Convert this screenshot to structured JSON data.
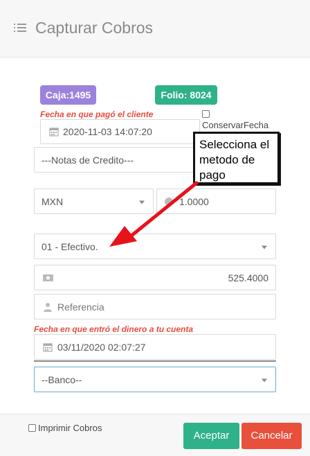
{
  "header": {
    "title": "Capturar Cobros",
    "icon": "list-icon"
  },
  "badges": {
    "caja": "Caja:1495",
    "folio": "Folio: 8024"
  },
  "labels": {
    "fecha_cliente": "Fecha en que pagó el cliente",
    "conservar_fecha": "ConservarFecha",
    "fecha_cuenta": "Fecha en que entró el dinero a tu cuenta"
  },
  "fields": {
    "fecha_pago": "2020-11-03 14:07:20",
    "notas_credito": "---Notas de Credito---",
    "moneda": "MXN",
    "tipo_cambio": "1.0000",
    "metodo_pago": "01 - Efectivo.",
    "monto": "525.4000",
    "referencia_placeholder": "Referencia",
    "fecha_deposito": "03/11/2020 02:07:27",
    "banco": "--Banco--"
  },
  "callout": {
    "text": "Selecciona el metodo de pago"
  },
  "footer": {
    "imprimir_label": "Imprimir Cobros",
    "aceptar": "Aceptar",
    "cancelar": "Cancelar"
  },
  "colors": {
    "caja_badge": "#9b82dc",
    "folio_badge": "#2fb18a",
    "label_red": "#e74c3c",
    "arrow_red": "#e8121b",
    "accept": "#2fb18a",
    "cancel": "#e9503c"
  }
}
